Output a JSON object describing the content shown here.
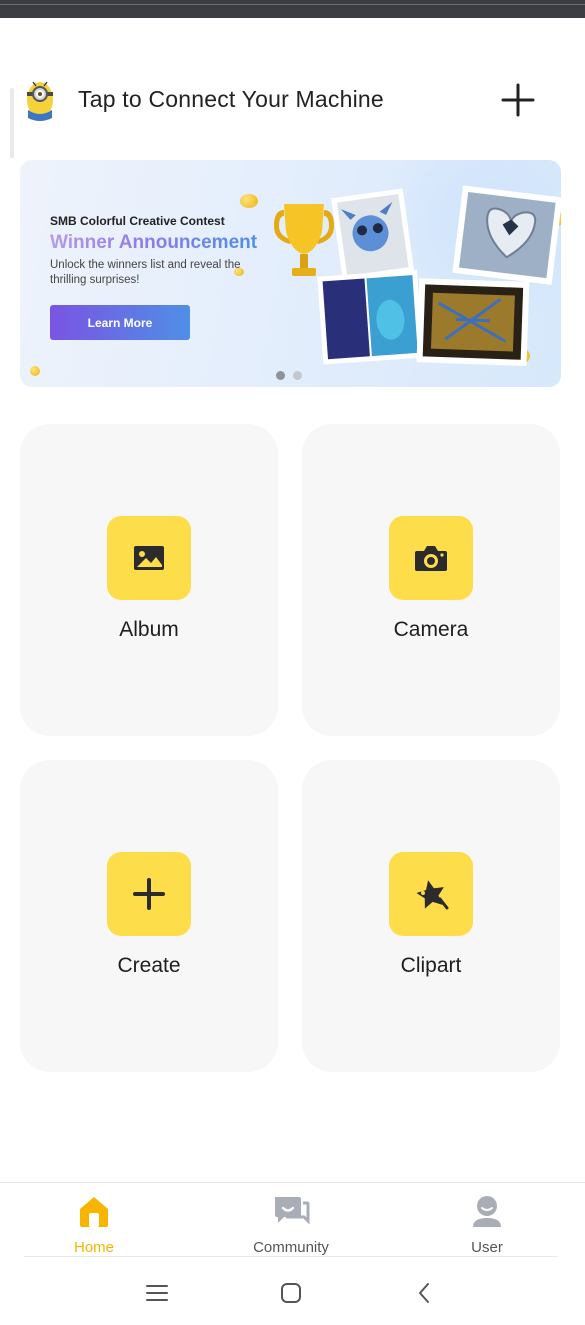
{
  "header": {
    "title": "Tap to Connect Your Machine",
    "avatar_icon": "minion-avatar-icon",
    "add_icon": "plus-icon"
  },
  "banner": {
    "kicker": "SMB Colorful Creative Contest",
    "headline": "Winner Announcement",
    "description": "Unlock the winners list and reveal the thrilling surprises!",
    "cta_label": "Learn More",
    "page_count": 2,
    "active_page": 1
  },
  "tiles": [
    {
      "label": "Album",
      "icon": "image-icon"
    },
    {
      "label": "Camera",
      "icon": "camera-icon"
    },
    {
      "label": "Create",
      "icon": "plus-icon"
    },
    {
      "label": "Clipart",
      "icon": "star-icon"
    }
  ],
  "tabs": [
    {
      "label": "Home",
      "icon": "home-icon",
      "active": true
    },
    {
      "label": "Community",
      "icon": "chat-icon",
      "active": false
    },
    {
      "label": "User",
      "icon": "user-icon",
      "active": false
    }
  ],
  "system_nav": [
    "menu-icon",
    "home-square-icon",
    "back-icon"
  ],
  "colors": {
    "accent_yellow": "#fedd4a",
    "tab_active": "#f7b500",
    "cta_start": "#7a54e3",
    "cta_end": "#4f8fe6"
  }
}
